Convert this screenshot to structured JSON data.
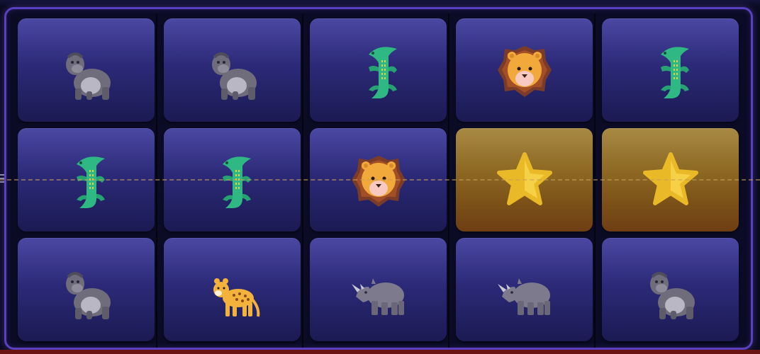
{
  "game": {
    "type": "slot-reels",
    "rows": 3,
    "columns": 5,
    "grid": [
      [
        "gorilla",
        "gorilla",
        "crocodile",
        "lion",
        "crocodile"
      ],
      [
        "crocodile",
        "crocodile",
        "lion",
        "star",
        "star"
      ],
      [
        "gorilla",
        "leopard",
        "rhino",
        "rhino",
        "gorilla"
      ]
    ],
    "winning_cells": [
      [
        1,
        3
      ],
      [
        1,
        4
      ]
    ],
    "payline": "middle-row"
  },
  "symbols": {
    "gorilla": {
      "icon": "gorilla-icon"
    },
    "crocodile": {
      "icon": "crocodile-icon"
    },
    "lion": {
      "icon": "lion-icon"
    },
    "star": {
      "icon": "star-icon"
    },
    "leopard": {
      "icon": "leopard-icon"
    },
    "rhino": {
      "icon": "rhino-icon"
    }
  },
  "colors": {
    "frame": "#5a3fc0",
    "cell": "#2c2a78",
    "win_cell": "#8e6a24",
    "payline": "#c8a05a"
  }
}
